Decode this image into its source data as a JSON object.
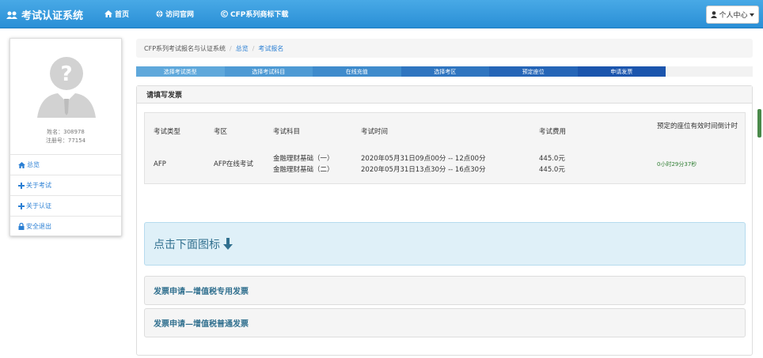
{
  "navbar": {
    "brand": "考试认证系统",
    "links": [
      {
        "label": "首页",
        "icon": "home-icon"
      },
      {
        "label": "访问官网",
        "icon": "globe-icon"
      },
      {
        "label": "CFP系列商标下载",
        "icon": "copyright-icon"
      }
    ],
    "user_menu": "个人中心"
  },
  "sidebar": {
    "name_line": "姓名：308978",
    "reg_line": "注册号：77154",
    "items": [
      {
        "label": "总览",
        "icon": "home-icon"
      },
      {
        "label": "关于考试",
        "icon": "plus-icon"
      },
      {
        "label": "关于认证",
        "icon": "plus-icon"
      },
      {
        "label": "安全退出",
        "icon": "lock-icon"
      }
    ]
  },
  "breadcrumb": [
    "CFP系列考试报名与认证系统",
    "总览",
    "考试报名"
  ],
  "steps": [
    {
      "label": "选择考试类型",
      "color": "#5fa8db"
    },
    {
      "label": "选择考试科目",
      "color": "#4e9ad4"
    },
    {
      "label": "在线充值",
      "color": "#3f8bcc"
    },
    {
      "label": "选择考区",
      "color": "#2f75c0"
    },
    {
      "label": "预定座位",
      "color": "#2565b7"
    },
    {
      "label": "申请发票",
      "color": "#1b55ad"
    }
  ],
  "panel": {
    "title": "请填写发票",
    "table": {
      "headers": [
        "考试类型",
        "考区",
        "考试科目",
        "考试时间",
        "考试费用",
        "预定的座位有效时间倒计时"
      ],
      "row": {
        "type": "AFP",
        "area": "AFP在线考试",
        "subjects": [
          "金融理财基础（一）",
          "金融理财基础（二）"
        ],
        "times": [
          "2020年05月31日09点00分 -- 12点00分",
          "2020年05月31日13点30分 -- 16点30分"
        ],
        "fees": [
          "445.0元",
          "445.0元"
        ],
        "countdown": "0小时29分37秒"
      }
    },
    "alert": "点击下面图标",
    "invoice_options": [
      "发票申请—增值税专用发票",
      "发票申请—增值税普通发票"
    ]
  }
}
